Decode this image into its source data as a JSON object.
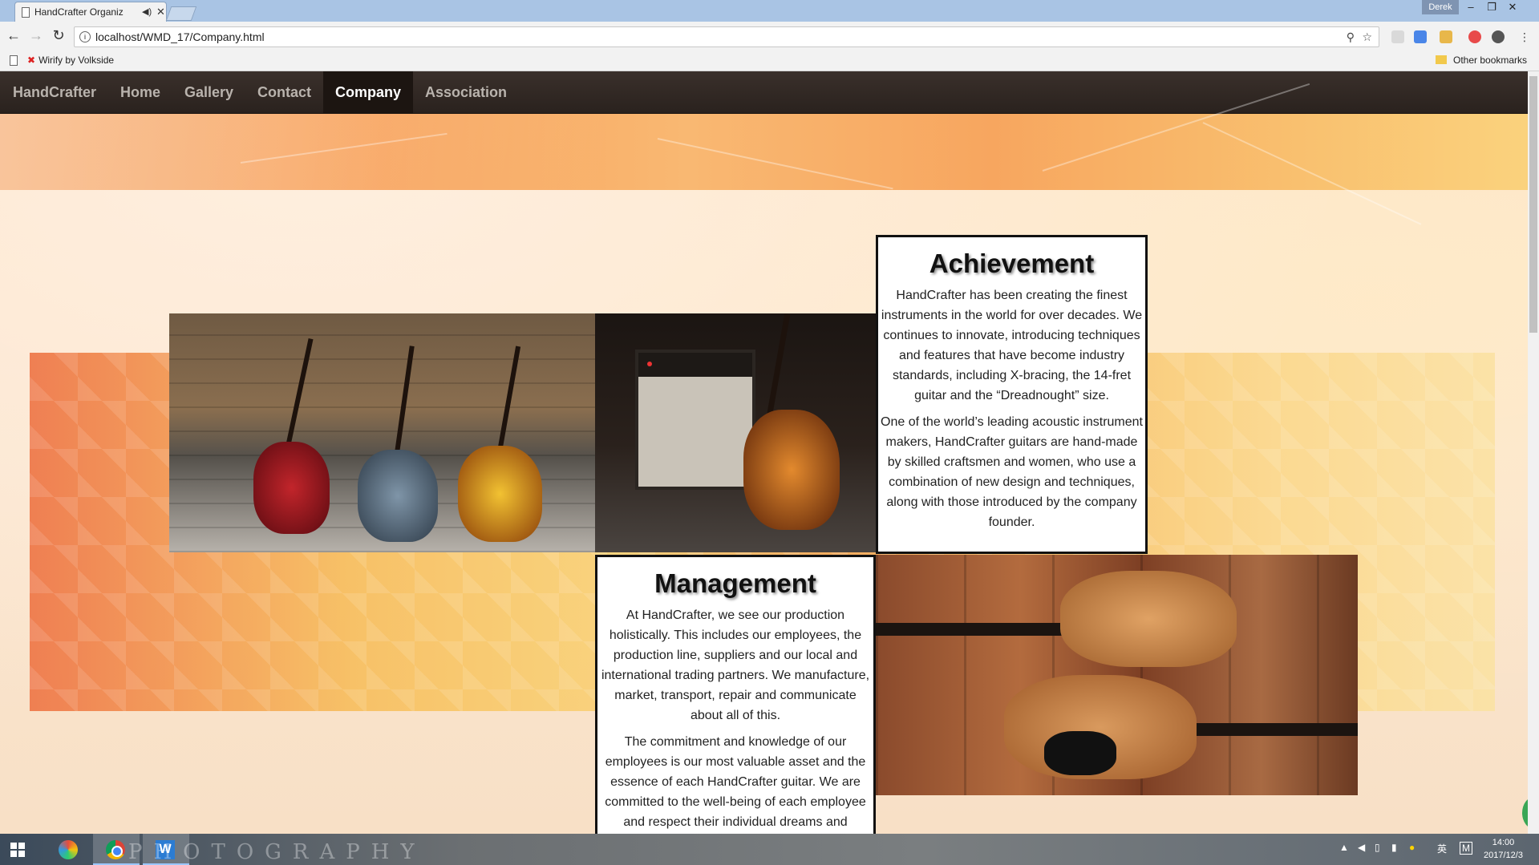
{
  "browser": {
    "tab_title": "HandCrafter Organiz",
    "profile_name": "Derek",
    "url": "localhost/WMD_17/Company.html",
    "bookmark_left": "Wirify by Volkside",
    "bookmark_right": "Other bookmarks"
  },
  "nav": {
    "brand": "HandCrafter",
    "items": [
      "Home",
      "Gallery",
      "Contact",
      "Company",
      "Association"
    ],
    "active": "Company"
  },
  "achievement": {
    "title": "Achievement",
    "p1": "HandCrafter has been creating the finest instruments in the world for over decades. We continues to innovate, introducing techniques and features that have become industry standards, including X-bracing, the 14-fret guitar and the “Dreadnought” size.",
    "p2": "One of the world’s leading acoustic instrument makers, HandCrafter guitars are hand-made by skilled craftsmen and women, who use a combination of new design and techniques, along with those introduced by the company founder."
  },
  "management": {
    "title": "Management",
    "p1": "At HandCrafter, we see our production holistically. This includes our employees, the production line, suppliers and our local and international trading partners. We manufacture, market, transport, repair and communicate about all of this.",
    "p2": "The commitment and knowledge of our employees is our most valuable asset and the essence of each HandCrafter guitar. We are committed to the well-being of each employee and respect their individual dreams and"
  },
  "taskbar": {
    "watermark": "PHOTOGRAPHY",
    "ime": "英",
    "ime2": "M",
    "time": "14:00",
    "date": "2017/12/3"
  },
  "colors": {
    "navbar": "#2f2622",
    "active_nav": "#1c1511",
    "card_border": "#111111"
  }
}
